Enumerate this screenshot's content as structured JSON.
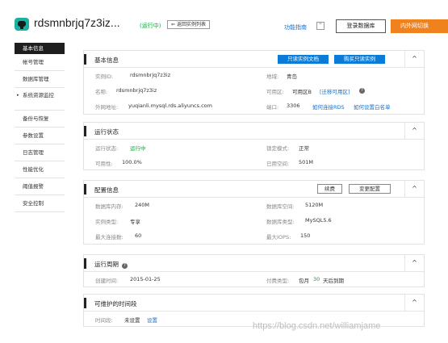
{
  "header": {
    "instance_name": "rdsmnbrjq7z3iz...",
    "status": "(运行中)",
    "back_button": "返回实例列表",
    "guide_link": "功能指南",
    "guide_toggle": "^",
    "login_button": "登录数据库",
    "switch_button": "内外网切换"
  },
  "sidebar": {
    "items": [
      {
        "label": "基本信息",
        "active": true
      },
      {
        "label": "帐号管理"
      },
      {
        "label": "数据库管理"
      },
      {
        "label": "系统资源监控",
        "sub": "控",
        "expandable": true
      },
      {
        "label": "备份与恢复"
      },
      {
        "label": "参数设置"
      },
      {
        "label": "日志管理"
      },
      {
        "label": "性能优化"
      },
      {
        "label": "阈值报警"
      },
      {
        "label": "安全控制"
      }
    ],
    "expand_arrow": "▸"
  },
  "basic_info": {
    "title": "基本信息",
    "btn_readonly_doc": "只读实例文档",
    "btn_buy_readonly": "购买只读实例",
    "collapse": "^",
    "instance_id_label": "实例ID:",
    "instance_id": "rdsmnbrjq7z3iz",
    "region_label": "地域:",
    "region": "青岛",
    "name_label": "名称:",
    "name": "rdsmnbrjq7z3iz",
    "zone_label": "可用区:",
    "zone": "可用区B",
    "zone_link": "[迁移可用区]",
    "external_addr_label": "外网地址:",
    "external_addr": "yuqianli.mysql.rds.aliyuncs.com",
    "port_label": "端口:",
    "port": "3306",
    "connect_link": "如何连接RDS",
    "whitelist_link": "如何设置白名单"
  },
  "runtime_status": {
    "title": "运行状态",
    "collapse": "^",
    "run_state_label": "运行状态:",
    "run_state": "运行中",
    "lock_mode_label": "锁定模式:",
    "lock_mode": "正常",
    "availability_label": "可用性:",
    "availability": "100.0%",
    "used_space_label": "已用空间:",
    "used_space": "501M"
  },
  "config_info": {
    "title": "配置信息",
    "btn_renew": "续费",
    "btn_change": "变更配置",
    "collapse": "^",
    "memory_label": "数据库内存:",
    "memory": "240M",
    "storage_label": "数据库空间:",
    "storage": "5120M",
    "instance_type_label": "实例类型:",
    "instance_type": "专享",
    "db_type_label": "数据库类型:",
    "db_type": "MySQL5.6",
    "max_conn_label": "最大连接数:",
    "max_conn": "60",
    "max_iops_label": "最大IOPS:",
    "max_iops": "150"
  },
  "run_period": {
    "title": "运行周期",
    "collapse": "^",
    "created_label": "创建时间:",
    "created": "2015-01-25",
    "pay_type_label": "付费类型:",
    "pay_type": "包月",
    "days": "30",
    "expire_suffix": "天后到期"
  },
  "maintenance": {
    "title": "可维护的时间段",
    "collapse": "^",
    "time_label": "时间段:",
    "time_value": "未设置",
    "set_link": "设置"
  },
  "watermark": "https://blog.csdn.net/williamjame"
}
